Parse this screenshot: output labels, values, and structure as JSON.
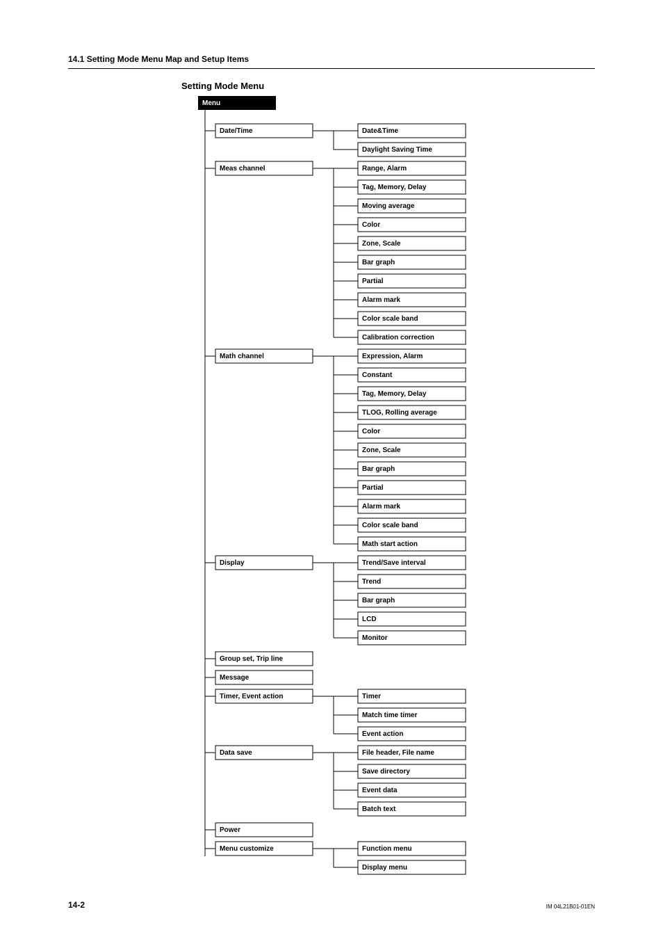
{
  "header": {
    "section": "14.1  Setting Mode Menu Map and Setup Items",
    "subsection": "Setting Mode Menu"
  },
  "root": "Menu",
  "left": {
    "date_time": "Date/Time",
    "meas_channel": "Meas channel",
    "math_channel": "Math channel",
    "display": "Display",
    "group_set": "Group set, Trip line",
    "message": "Message",
    "timer_event": "Timer, Event action",
    "data_save": "Data save",
    "power": "Power",
    "menu_customize": "Menu customize"
  },
  "right": {
    "date_time_0": "Date&Time",
    "date_time_1": "Daylight Saving Time",
    "meas_0": "Range, Alarm",
    "meas_1": "Tag, Memory, Delay",
    "meas_2": "Moving average",
    "meas_3": "Color",
    "meas_4": "Zone, Scale",
    "meas_5": "Bar graph",
    "meas_6": "Partial",
    "meas_7": "Alarm mark",
    "meas_8": "Color scale band",
    "meas_9": "Calibration correction",
    "math_0": "Expression, Alarm",
    "math_1": "Constant",
    "math_2": "Tag, Memory, Delay",
    "math_3": "TLOG, Rolling average",
    "math_4": "Color",
    "math_5": "Zone, Scale",
    "math_6": "Bar graph",
    "math_7": "Partial",
    "math_8": "Alarm mark",
    "math_9": "Color scale band",
    "math_10": "Math start action",
    "disp_0": "Trend/Save interval",
    "disp_1": "Trend",
    "disp_2": "Bar graph",
    "disp_3": "LCD",
    "disp_4": "Monitor",
    "timer_0": "Timer",
    "timer_1": "Match time timer",
    "timer_2": "Event action",
    "save_0": "File header, File name",
    "save_1": "Save directory",
    "save_2": "Event data",
    "save_3": "Batch text",
    "custom_0": "Function menu",
    "custom_1": "Display menu"
  },
  "footer": {
    "page": "14-2",
    "docid": "IM 04L21B01-01EN"
  },
  "chart_data": {
    "type": "tree",
    "root": "Menu",
    "children": [
      {
        "label": "Date/Time",
        "children": [
          "Date&Time",
          "Daylight Saving Time"
        ]
      },
      {
        "label": "Meas channel",
        "children": [
          "Range, Alarm",
          "Tag, Memory, Delay",
          "Moving average",
          "Color",
          "Zone, Scale",
          "Bar graph",
          "Partial",
          "Alarm mark",
          "Color scale band",
          "Calibration correction"
        ]
      },
      {
        "label": "Math channel",
        "children": [
          "Expression, Alarm",
          "Constant",
          "Tag, Memory, Delay",
          "TLOG, Rolling average",
          "Color",
          "Zone, Scale",
          "Bar graph",
          "Partial",
          "Alarm mark",
          "Color scale band",
          "Math start action"
        ]
      },
      {
        "label": "Display",
        "children": [
          "Trend/Save interval",
          "Trend",
          "Bar graph",
          "LCD",
          "Monitor"
        ]
      },
      {
        "label": "Group set, Trip line",
        "children": []
      },
      {
        "label": "Message",
        "children": []
      },
      {
        "label": "Timer, Event action",
        "children": [
          "Timer",
          "Match time timer",
          "Event action"
        ]
      },
      {
        "label": "Data save",
        "children": [
          "File header, File name",
          "Save directory",
          "Event data",
          "Batch text"
        ]
      },
      {
        "label": "Power",
        "children": []
      },
      {
        "label": "Menu customize",
        "children": [
          "Function menu",
          "Display menu"
        ]
      }
    ]
  }
}
